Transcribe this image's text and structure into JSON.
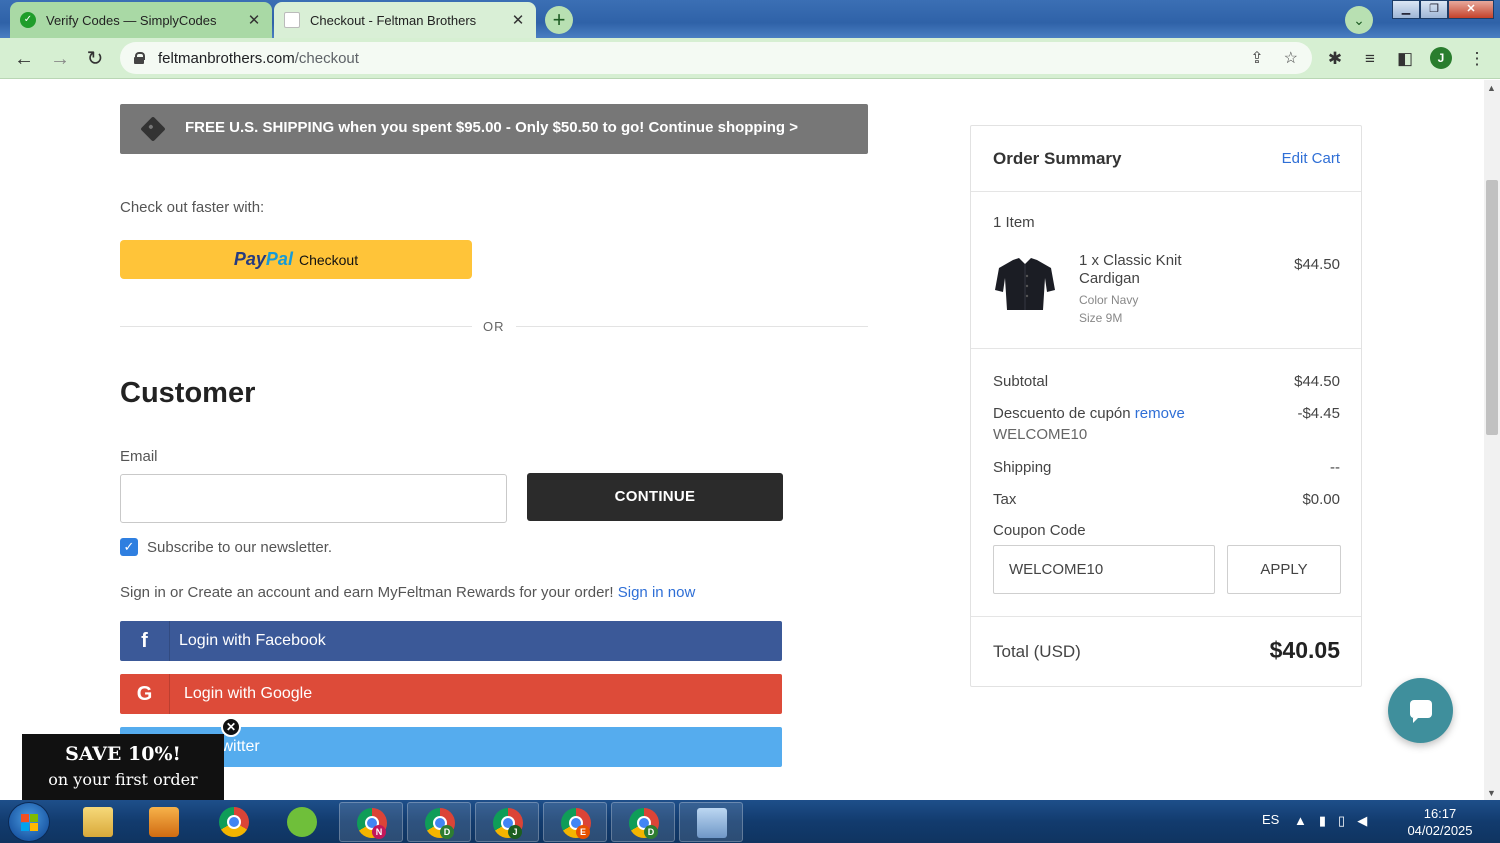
{
  "browser": {
    "tabs": [
      {
        "title": "Verify Codes — SimplyCodes",
        "close": "✕"
      },
      {
        "title": "Checkout - Feltman Brothers",
        "close": "✕"
      }
    ],
    "url_host": "feltmanbrothers.com",
    "url_path": "/checkout",
    "profile_initial": "J",
    "new_tab": "+"
  },
  "banner": {
    "text": "FREE U.S. SHIPPING when you spent $95.00 - Only $50.50 to go! Continue shopping >"
  },
  "checkout": {
    "faster_label": "Check out faster with:",
    "paypal_logo_1": "Pay",
    "paypal_logo_2": "Pal",
    "paypal_label": "Checkout",
    "or_label": "OR",
    "customer_heading": "Customer",
    "email_label": "Email",
    "email_value": "",
    "continue_label": "CONTINUE",
    "newsletter_label": "Subscribe to our newsletter.",
    "signin_text": "Sign in or Create an account and earn MyFeltman Rewards for your order!",
    "signin_link": "Sign in now",
    "facebook_label": "Login with Facebook",
    "google_label": "Login with Google",
    "twitter_label": "with Twitter"
  },
  "summary": {
    "title": "Order Summary",
    "edit_cart": "Edit Cart",
    "item_count": "1 Item",
    "item": {
      "name": "1 x Classic Knit Cardigan",
      "color": "Color Navy",
      "size": "Size 9M",
      "price": "$44.50"
    },
    "subtotal_label": "Subtotal",
    "subtotal_value": "$44.50",
    "discount_label": "Descuento de cupón",
    "discount_remove": "remove",
    "discount_code": "WELCOME10",
    "discount_value": "-$4.45",
    "shipping_label": "Shipping",
    "shipping_value": "--",
    "tax_label": "Tax",
    "tax_value": "$0.00",
    "coupon_label": "Coupon Code",
    "coupon_value": "WELCOME10",
    "apply_label": "APPLY",
    "total_label": "Total (USD)",
    "total_value": "$40.05"
  },
  "popup": {
    "title": "SAVE 10%!",
    "subtitle": "on your first order"
  },
  "taskbar": {
    "badges": [
      "N",
      "D",
      "J",
      "E",
      "D"
    ],
    "language": "ES",
    "time": "16:17",
    "date": "04/02/2025"
  },
  "colors": {
    "facebook": "#3b5998",
    "google": "#dd4b39",
    "twitter": "#55acee",
    "paypal_yellow": "#ffc439",
    "link_blue": "#2f6fd6"
  }
}
